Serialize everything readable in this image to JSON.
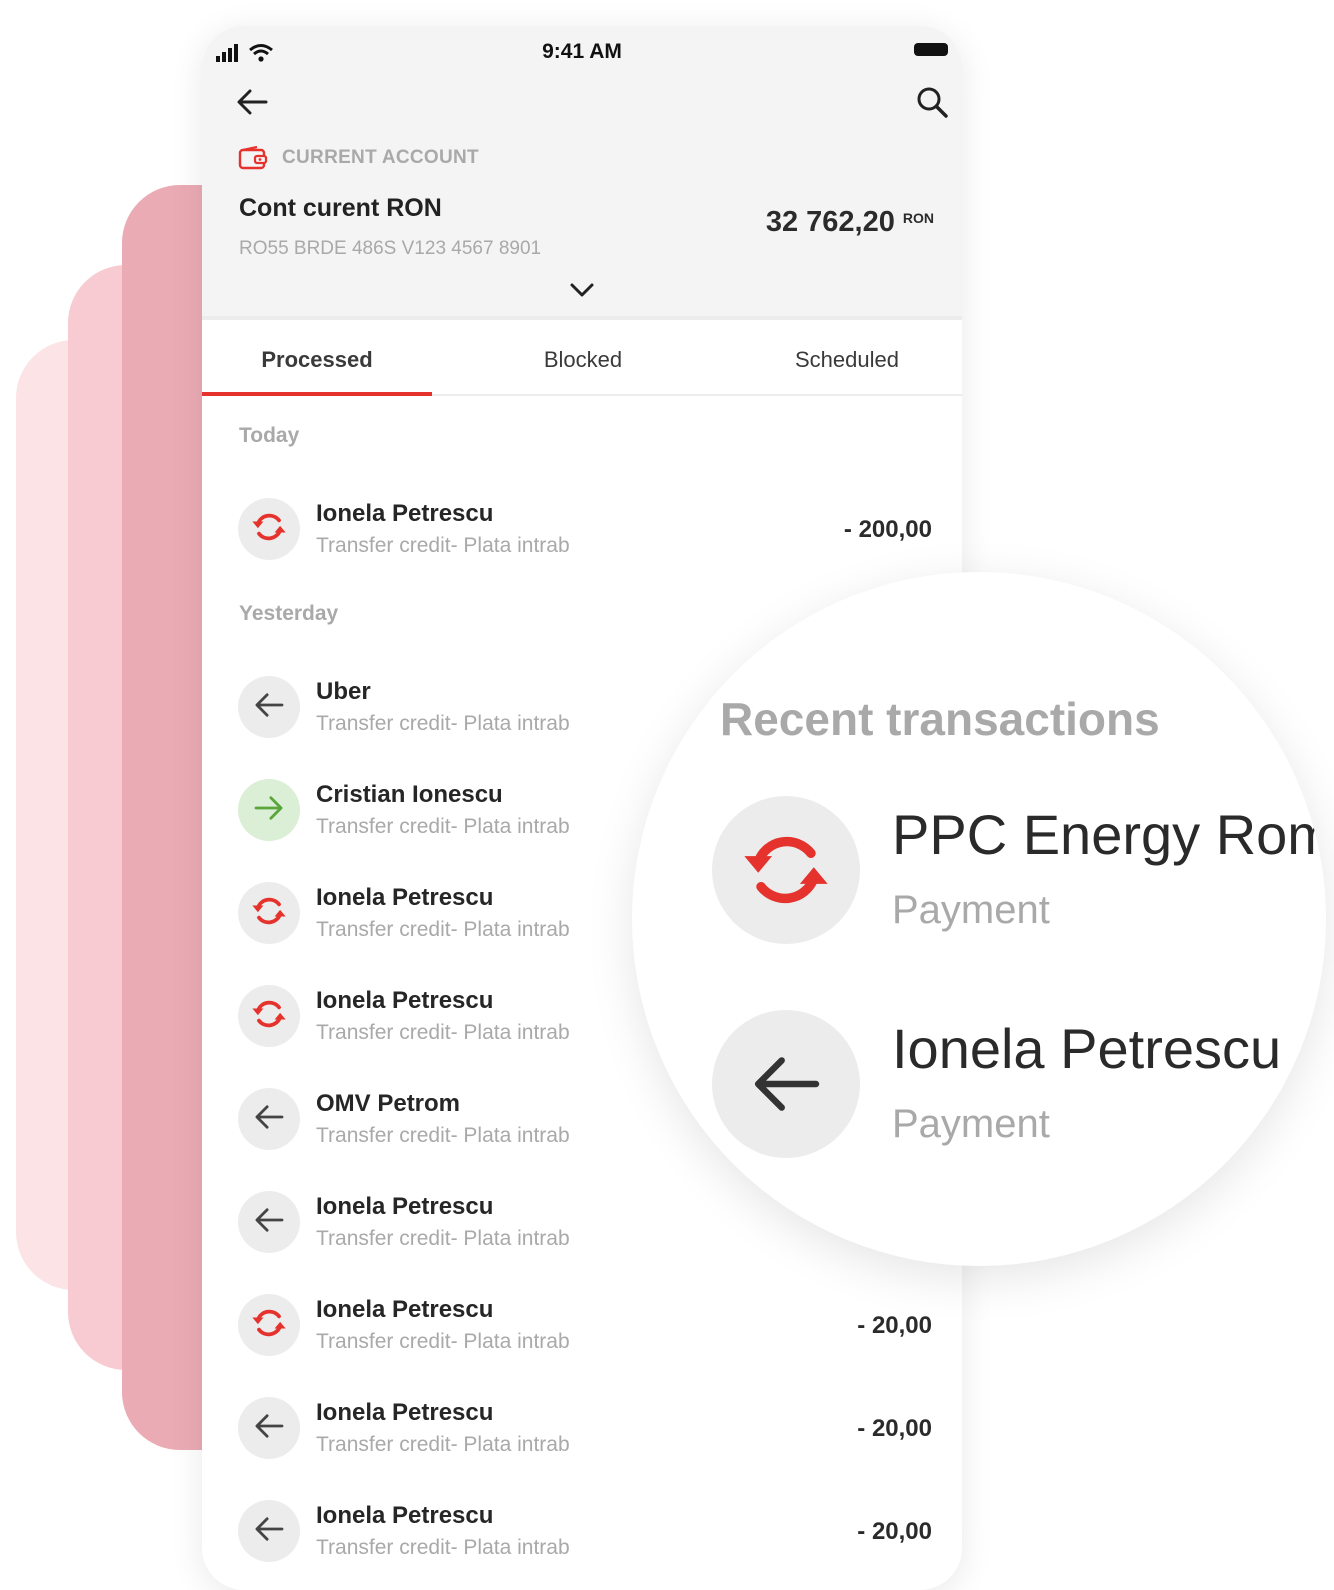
{
  "status_bar": {
    "time": "9:41 AM"
  },
  "header": {
    "account_kind": "CURRENT ACCOUNT",
    "account_name": "Cont curent RON",
    "iban": "RO55 BRDE 486S V123 4567 8901",
    "balance": "32 762,20",
    "currency": "RON"
  },
  "tabs": [
    {
      "label": "Processed",
      "active": true
    },
    {
      "label": "Blocked",
      "active": false
    },
    {
      "label": "Scheduled",
      "active": false
    }
  ],
  "sections": {
    "today": "Today",
    "yesterday": "Yesterday"
  },
  "transactions": [
    {
      "name": "Ionela Petrescu",
      "desc": "Transfer credit- Plata intrab",
      "amount": "- 200,00",
      "icon": "exchange-icon"
    },
    {
      "name": "Uber",
      "desc": "Transfer credit- Plata intrab",
      "amount": "",
      "icon": "arrow-left-icon"
    },
    {
      "name": "Cristian Ionescu",
      "desc": "Transfer credit- Plata intrab",
      "amount": "",
      "icon": "arrow-right-icon"
    },
    {
      "name": "Ionela Petrescu",
      "desc": "Transfer credit- Plata intrab",
      "amount": "",
      "icon": "exchange-icon"
    },
    {
      "name": "Ionela Petrescu",
      "desc": "Transfer credit- Plata intrab",
      "amount": "",
      "icon": "exchange-icon"
    },
    {
      "name": "OMV Petrom",
      "desc": "Transfer credit- Plata intrab",
      "amount": "",
      "icon": "arrow-left-icon"
    },
    {
      "name": "Ionela Petrescu",
      "desc": "Transfer credit- Plata intrab",
      "amount": "",
      "icon": "arrow-left-icon"
    },
    {
      "name": "Ionela Petrescu",
      "desc": "Transfer credit- Plata intrab",
      "amount": "- 20,00",
      "icon": "exchange-icon"
    },
    {
      "name": "Ionela Petrescu",
      "desc": "Transfer credit- Plata intrab",
      "amount": "- 20,00",
      "icon": "arrow-left-icon"
    },
    {
      "name": "Ionela Petrescu",
      "desc": "Transfer credit- Plata intrab",
      "amount": "- 20,00",
      "icon": "arrow-left-icon"
    }
  ],
  "magnifier": {
    "title": "Recent transactions",
    "items": [
      {
        "name": "PPC Energy Rom",
        "desc": "Payment",
        "icon": "exchange-icon"
      },
      {
        "name": "Ionela Petrescu",
        "desc": "Payment",
        "icon": "arrow-left-icon"
      }
    ]
  },
  "colors": {
    "accent": "#e5322d",
    "positive": "#5aa63b",
    "muted": "#a9a9a9"
  }
}
